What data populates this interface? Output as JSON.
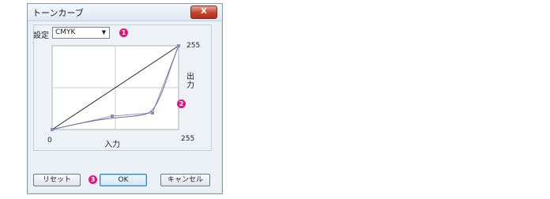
{
  "window": {
    "title": "トーンカーブ",
    "close_glyph": "X"
  },
  "setting": {
    "label": "設定",
    "selected": "CMYK",
    "arrow": "▼"
  },
  "markers": [
    "1",
    "2",
    "3"
  ],
  "graph": {
    "x_min": "0",
    "x_max": "255",
    "y_max": "255",
    "x_label": "入力",
    "y_label": "出力"
  },
  "buttons": {
    "reset": "リセット",
    "ok": "OK",
    "cancel": "キャンセル"
  },
  "colors": {
    "marker": "#e4157a",
    "curve": "#8a8fb8",
    "close": "#c2432c"
  }
}
